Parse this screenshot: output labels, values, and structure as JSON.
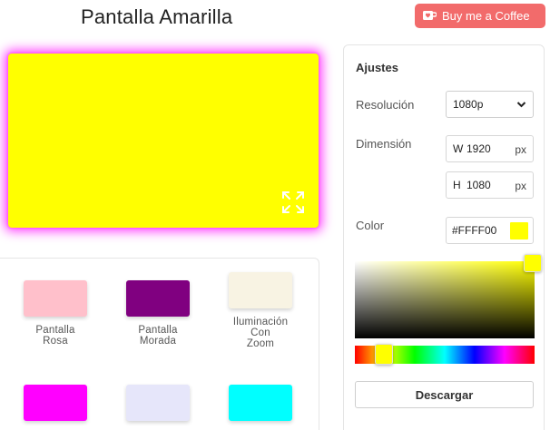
{
  "header": {
    "title": "Pantalla Amarilla",
    "coffee_button": {
      "label": "Buy me a Coffee",
      "icon": "coffee-cup-icon",
      "color": "#f26b6b"
    }
  },
  "preview": {
    "color": "#FFFF00",
    "glow_color": "#ff44ff",
    "fullscreen_icon": "fullscreen-expand-icon"
  },
  "presets": [
    {
      "label_lines": [
        "Pantalla",
        "Rosa"
      ],
      "color": "#ffc0cb"
    },
    {
      "label_lines": [
        "Pantalla",
        "Morada"
      ],
      "color": "#800080"
    },
    {
      "label_lines": [
        "Iluminación",
        "Con",
        "Zoom"
      ],
      "color": "#f8f3e3"
    },
    {
      "label_lines": [],
      "color": "#ff00ff"
    },
    {
      "label_lines": [],
      "color": "#e6e6fa"
    },
    {
      "label_lines": [],
      "color": "#00ffff"
    }
  ],
  "settings": {
    "title": "Ajustes",
    "resolution": {
      "label": "Resolución",
      "value": "1080p"
    },
    "dimension": {
      "label": "Dimensión",
      "width": {
        "prefix": "W",
        "value": "1920",
        "unit": "px"
      },
      "height": {
        "prefix": "H",
        "value": "1080",
        "unit": "px"
      }
    },
    "color": {
      "label": "Color",
      "hex": "#FFFF00",
      "swatch": "#ffff00"
    },
    "download_label": "Descargar"
  }
}
